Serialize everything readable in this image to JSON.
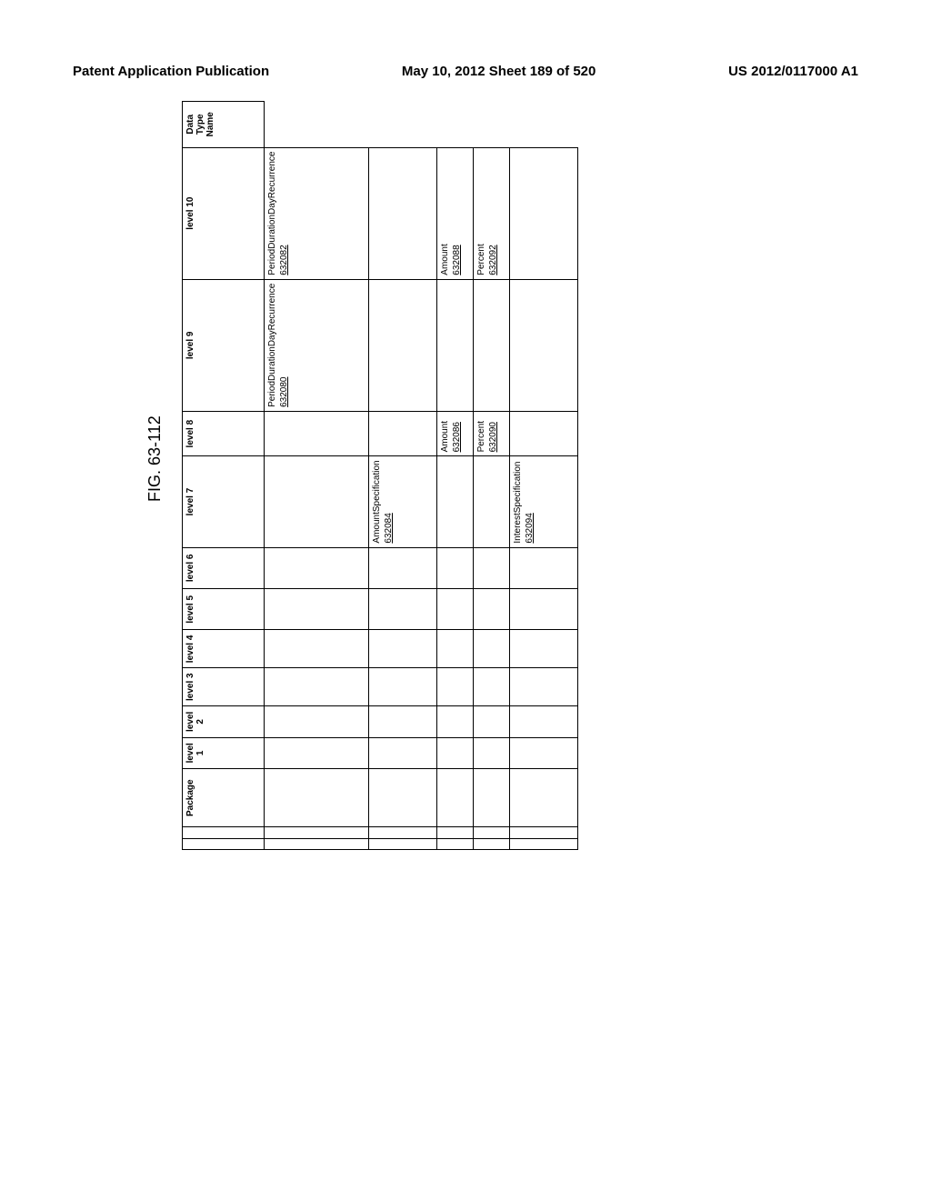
{
  "header": {
    "left": "Patent Application Publication",
    "center": "May 10, 2012  Sheet 189 of 520",
    "right": "US 2012/0117000 A1"
  },
  "figure_label": "FIG. 63-112",
  "table": {
    "headers": {
      "package": "Package",
      "l1": "level 1",
      "l2": "level 2",
      "l3": "level 3",
      "l4": "level 4",
      "l5": "level 5",
      "l6": "level 6",
      "l7": "level 7",
      "l8": "level 8",
      "l9": "level 9",
      "l10": "level 10",
      "dt": "Data Type Name"
    },
    "rows": [
      {
        "l10": {
          "text": "PeriodDurationDayRecurrence",
          "ref": "632080"
        },
        "dt": {
          "text": "PeriodDurationDayRecurrence",
          "ref": "632082"
        }
      },
      {
        "l8": {
          "text": "AmountSpecification",
          "ref": "632084"
        }
      },
      {
        "l9": {
          "text": "Amount",
          "ref": "632086"
        },
        "dt": {
          "text": "Amount",
          "ref": "632088"
        }
      },
      {
        "l9": {
          "text": "Percent",
          "ref": "632090"
        },
        "dt": {
          "text": "Percent",
          "ref": "632092"
        }
      },
      {
        "l8": {
          "text": "InterestSpecification",
          "ref": "632094"
        }
      }
    ]
  }
}
